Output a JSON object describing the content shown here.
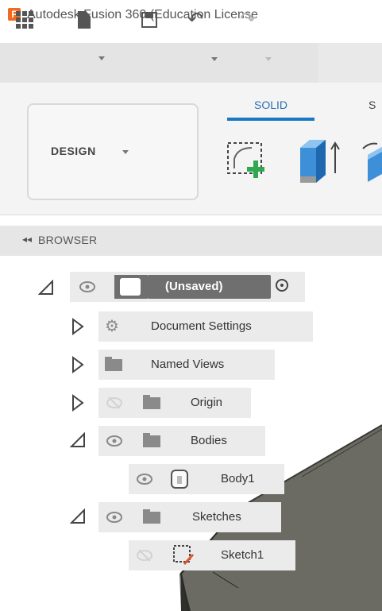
{
  "window": {
    "logo_letter": "F",
    "title": "Autodesk Fusion 360 (Education License"
  },
  "toolbar": {
    "icons": [
      "grid-menu-icon",
      "file-icon",
      "save-icon",
      "undo-icon",
      "redo-icon"
    ]
  },
  "ribbon": {
    "workspace_label": "DESIGN",
    "tabs": [
      {
        "label": "SOLID",
        "active": true
      },
      {
        "label": "S",
        "active": false
      }
    ],
    "tools": [
      "create-sketch-icon",
      "extrude-icon",
      "revolve-icon"
    ],
    "accent_color": "#1a78c2"
  },
  "browser": {
    "title": "BROWSER",
    "toggle": "◂◂",
    "root": {
      "label": "(Unsaved)"
    },
    "items": [
      {
        "label": "Document Settings",
        "icon": "gear-icon",
        "expanded": false,
        "visible": true
      },
      {
        "label": "Named Views",
        "icon": "folder-icon",
        "expanded": false,
        "visible": true
      },
      {
        "label": "Origin",
        "icon": "folder-icon",
        "expanded": false,
        "visible": false
      },
      {
        "label": "Bodies",
        "icon": "folder-icon",
        "expanded": true,
        "visible": true
      },
      {
        "label": "Body1",
        "icon": "body-icon",
        "visible": true
      },
      {
        "label": "Sketches",
        "icon": "folder-icon",
        "expanded": true,
        "visible": true
      },
      {
        "label": "Sketch1",
        "icon": "sketch-icon",
        "visible": false
      }
    ]
  }
}
